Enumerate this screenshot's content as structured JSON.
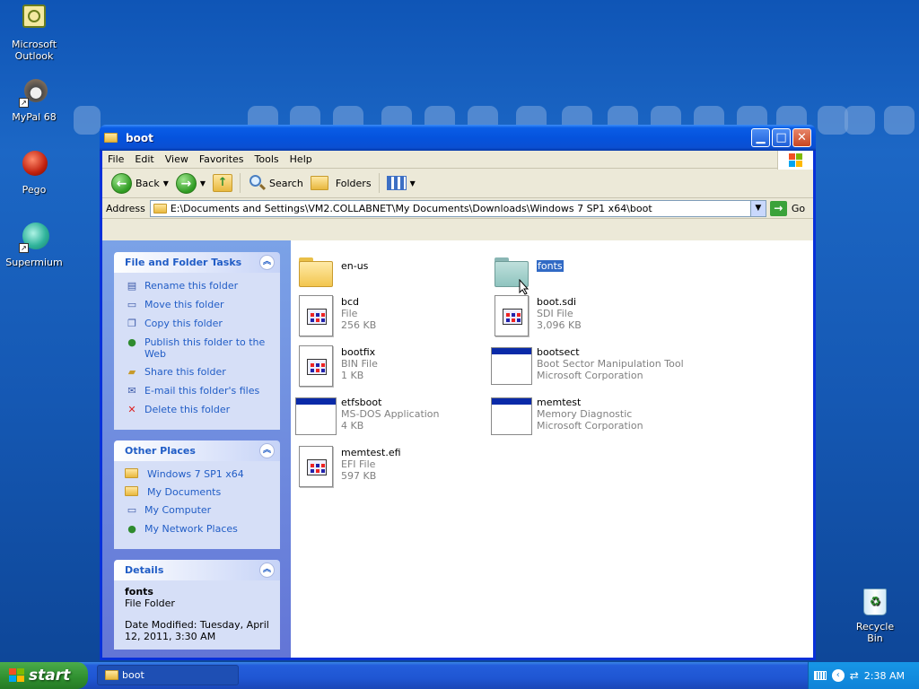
{
  "desktop": {
    "icons": [
      {
        "label": "Microsoft Outlook",
        "icon": "outlook-icon"
      },
      {
        "label": "MyPal 68",
        "icon": "mypal-icon"
      },
      {
        "label": "Pego",
        "icon": "pego-icon"
      },
      {
        "label": "Supermium",
        "icon": "supermium-icon"
      }
    ],
    "recycle_bin": "Recycle Bin"
  },
  "window": {
    "title": "boot",
    "menu": [
      "File",
      "Edit",
      "View",
      "Favorites",
      "Tools",
      "Help"
    ],
    "toolbar": {
      "back": "Back",
      "search": "Search",
      "folders": "Folders"
    },
    "address": {
      "label": "Address",
      "value": "E:\\Documents and Settings\\VM2.COLLABNET\\My Documents\\Downloads\\Windows 7 SP1 x64\\boot",
      "go": "Go"
    },
    "tasks": {
      "title": "File and Folder Tasks",
      "items": [
        "Rename this folder",
        "Move this folder",
        "Copy this folder",
        "Publish this folder to the Web",
        "Share this folder",
        "E-mail this folder's files",
        "Delete this folder"
      ]
    },
    "places": {
      "title": "Other Places",
      "items": [
        "Windows 7 SP1 x64",
        "My Documents",
        "My Computer",
        "My Network Places"
      ]
    },
    "details": {
      "title": "Details",
      "name": "fonts",
      "type": "File Folder",
      "modified": "Date Modified: Tuesday, April 12, 2011, 3:30 AM"
    },
    "files": [
      {
        "name": "en-us",
        "kind": "folder"
      },
      {
        "name": "fonts",
        "kind": "folder",
        "selected": true
      },
      {
        "name": "bcd",
        "line1": "File",
        "line2": "256 KB",
        "kind": "doc"
      },
      {
        "name": "boot.sdi",
        "line1": "SDI File",
        "line2": "3,096 KB",
        "kind": "doc"
      },
      {
        "name": "bootfix",
        "line1": "BIN File",
        "line2": "1 KB",
        "kind": "doc"
      },
      {
        "name": "bootsect",
        "line1": "Boot Sector Manipulation Tool",
        "line2": "Microsoft Corporation",
        "kind": "exe"
      },
      {
        "name": "etfsboot",
        "line1": "MS-DOS Application",
        "line2": "4 KB",
        "kind": "exe"
      },
      {
        "name": "memtest",
        "line1": "Memory Diagnostic",
        "line2": "Microsoft Corporation",
        "kind": "exe"
      },
      {
        "name": "memtest.efi",
        "line1": "EFI File",
        "line2": "597 KB",
        "kind": "doc"
      }
    ]
  },
  "taskbar": {
    "start": "start",
    "task": "boot",
    "clock": "2:38 AM"
  }
}
